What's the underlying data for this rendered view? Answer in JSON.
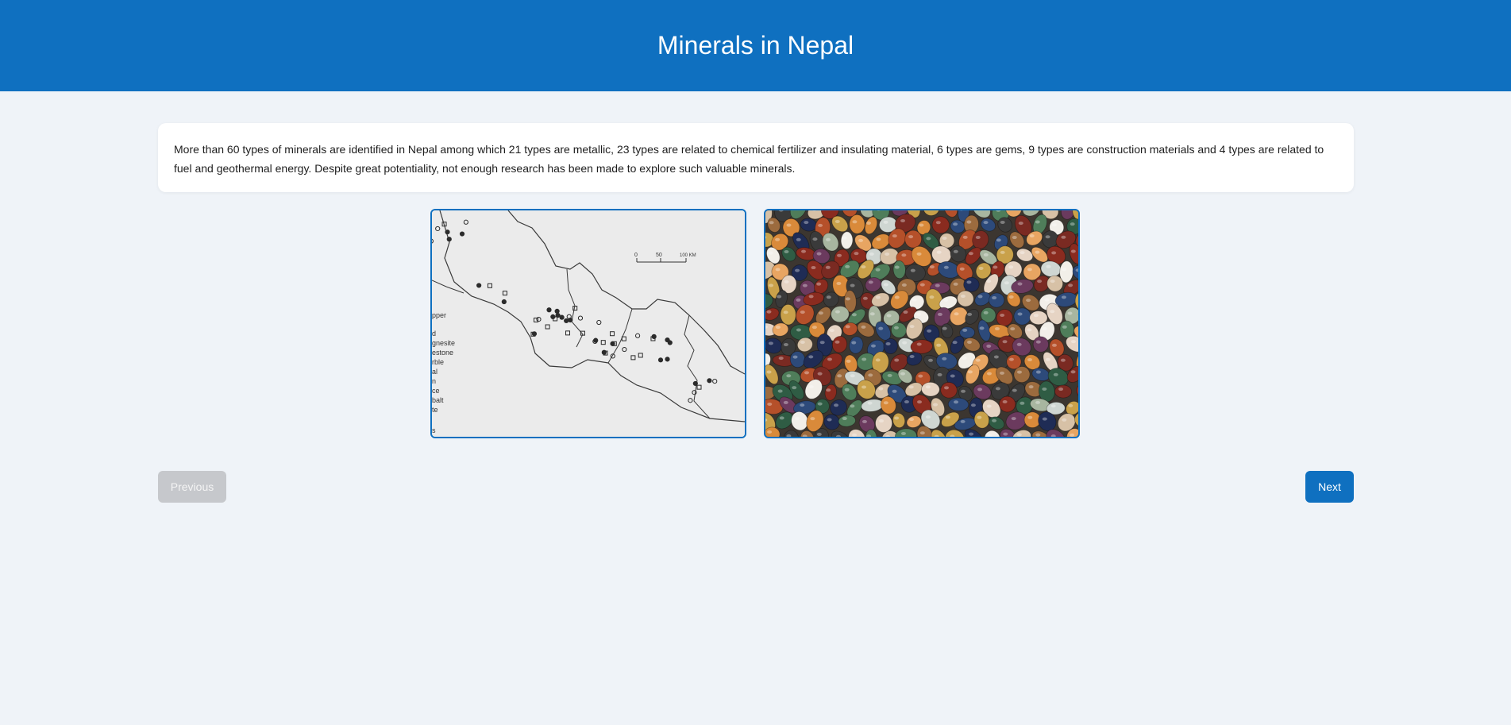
{
  "header": {
    "title": "Minerals in Nepal"
  },
  "content": {
    "paragraph": "More than 60 types of minerals are identified in Nepal among which 21 types are metallic, 23 types are related to chemical fertilizer and insulating material, 6 types are gems, 9 types are construction materials and 4 types are related to fuel and geothermal energy. Despite great potentiality, not enough research has been made to explore such valuable minerals."
  },
  "gallery": {
    "images": [
      {
        "name": "mineral-map",
        "scale_labels": [
          "0",
          "50",
          "100 KM"
        ],
        "legend_fragments": [
          "pper",
          "d",
          "gnesite",
          "estone",
          "rble",
          "al",
          "n",
          "ce",
          "balt",
          "te",
          "s"
        ]
      },
      {
        "name": "gemstones-photo"
      }
    ]
  },
  "navigation": {
    "previous_label": "Previous",
    "previous_disabled": true,
    "next_label": "Next"
  },
  "colors": {
    "header_bg": "#0f70c0",
    "page_bg": "#eff3f8",
    "accent": "#0f70c0",
    "disabled": "#c6c8cc"
  }
}
